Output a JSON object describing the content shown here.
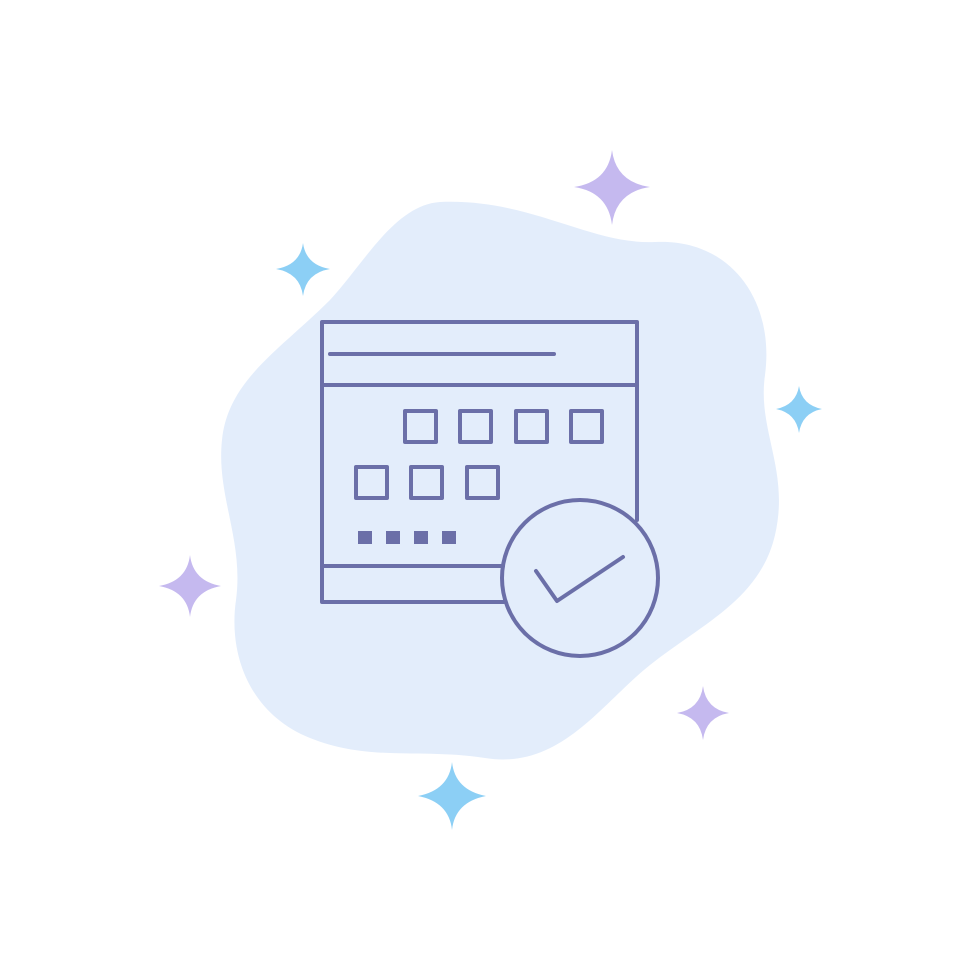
{
  "illustration": {
    "subject": "calendar-with-checkmark-icon",
    "colors": {
      "background": "#ffffff",
      "blob": "#e3edfb",
      "stroke": "#6b6fa8",
      "sparkle_blue": "#8ccff5",
      "sparkle_purple": "#c5b9ef"
    }
  }
}
